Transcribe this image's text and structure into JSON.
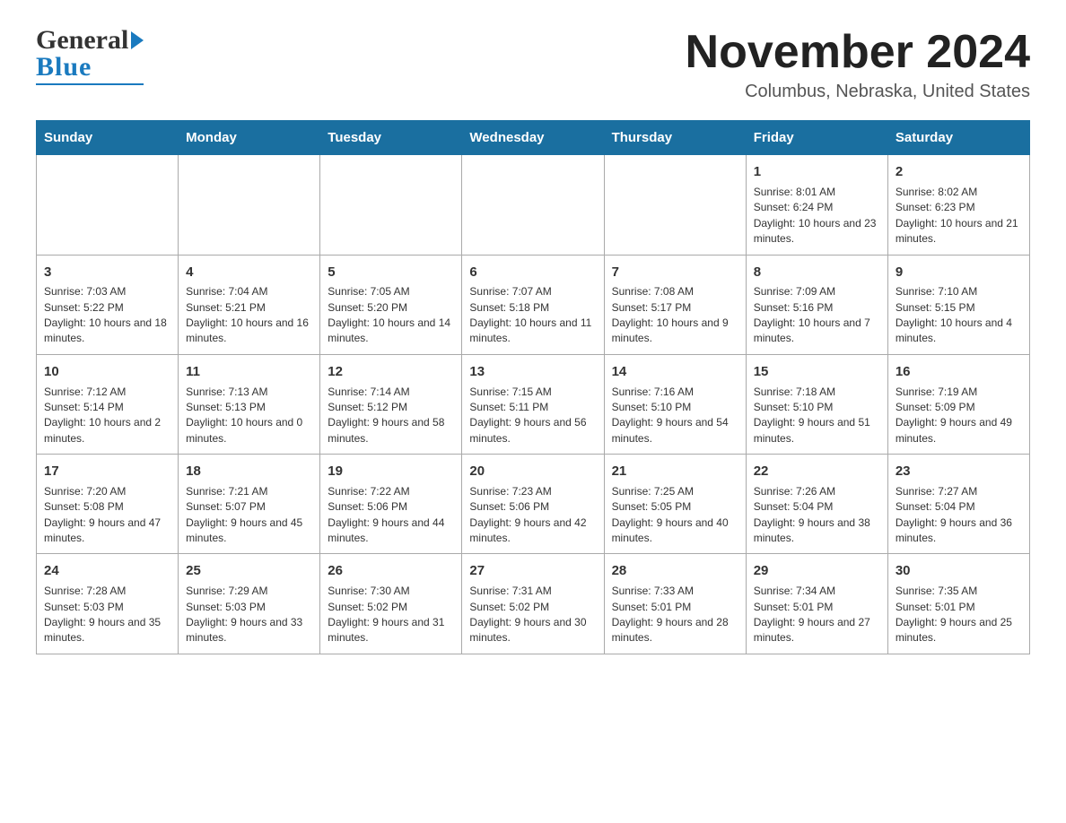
{
  "header": {
    "logo_general": "General",
    "logo_blue": "Blue",
    "month_title": "November 2024",
    "location": "Columbus, Nebraska, United States"
  },
  "weekdays": [
    "Sunday",
    "Monday",
    "Tuesday",
    "Wednesday",
    "Thursday",
    "Friday",
    "Saturday"
  ],
  "weeks": [
    [
      {
        "day": "",
        "info": ""
      },
      {
        "day": "",
        "info": ""
      },
      {
        "day": "",
        "info": ""
      },
      {
        "day": "",
        "info": ""
      },
      {
        "day": "",
        "info": ""
      },
      {
        "day": "1",
        "info": "Sunrise: 8:01 AM\nSunset: 6:24 PM\nDaylight: 10 hours and 23 minutes."
      },
      {
        "day": "2",
        "info": "Sunrise: 8:02 AM\nSunset: 6:23 PM\nDaylight: 10 hours and 21 minutes."
      }
    ],
    [
      {
        "day": "3",
        "info": "Sunrise: 7:03 AM\nSunset: 5:22 PM\nDaylight: 10 hours and 18 minutes."
      },
      {
        "day": "4",
        "info": "Sunrise: 7:04 AM\nSunset: 5:21 PM\nDaylight: 10 hours and 16 minutes."
      },
      {
        "day": "5",
        "info": "Sunrise: 7:05 AM\nSunset: 5:20 PM\nDaylight: 10 hours and 14 minutes."
      },
      {
        "day": "6",
        "info": "Sunrise: 7:07 AM\nSunset: 5:18 PM\nDaylight: 10 hours and 11 minutes."
      },
      {
        "day": "7",
        "info": "Sunrise: 7:08 AM\nSunset: 5:17 PM\nDaylight: 10 hours and 9 minutes."
      },
      {
        "day": "8",
        "info": "Sunrise: 7:09 AM\nSunset: 5:16 PM\nDaylight: 10 hours and 7 minutes."
      },
      {
        "day": "9",
        "info": "Sunrise: 7:10 AM\nSunset: 5:15 PM\nDaylight: 10 hours and 4 minutes."
      }
    ],
    [
      {
        "day": "10",
        "info": "Sunrise: 7:12 AM\nSunset: 5:14 PM\nDaylight: 10 hours and 2 minutes."
      },
      {
        "day": "11",
        "info": "Sunrise: 7:13 AM\nSunset: 5:13 PM\nDaylight: 10 hours and 0 minutes."
      },
      {
        "day": "12",
        "info": "Sunrise: 7:14 AM\nSunset: 5:12 PM\nDaylight: 9 hours and 58 minutes."
      },
      {
        "day": "13",
        "info": "Sunrise: 7:15 AM\nSunset: 5:11 PM\nDaylight: 9 hours and 56 minutes."
      },
      {
        "day": "14",
        "info": "Sunrise: 7:16 AM\nSunset: 5:10 PM\nDaylight: 9 hours and 54 minutes."
      },
      {
        "day": "15",
        "info": "Sunrise: 7:18 AM\nSunset: 5:10 PM\nDaylight: 9 hours and 51 minutes."
      },
      {
        "day": "16",
        "info": "Sunrise: 7:19 AM\nSunset: 5:09 PM\nDaylight: 9 hours and 49 minutes."
      }
    ],
    [
      {
        "day": "17",
        "info": "Sunrise: 7:20 AM\nSunset: 5:08 PM\nDaylight: 9 hours and 47 minutes."
      },
      {
        "day": "18",
        "info": "Sunrise: 7:21 AM\nSunset: 5:07 PM\nDaylight: 9 hours and 45 minutes."
      },
      {
        "day": "19",
        "info": "Sunrise: 7:22 AM\nSunset: 5:06 PM\nDaylight: 9 hours and 44 minutes."
      },
      {
        "day": "20",
        "info": "Sunrise: 7:23 AM\nSunset: 5:06 PM\nDaylight: 9 hours and 42 minutes."
      },
      {
        "day": "21",
        "info": "Sunrise: 7:25 AM\nSunset: 5:05 PM\nDaylight: 9 hours and 40 minutes."
      },
      {
        "day": "22",
        "info": "Sunrise: 7:26 AM\nSunset: 5:04 PM\nDaylight: 9 hours and 38 minutes."
      },
      {
        "day": "23",
        "info": "Sunrise: 7:27 AM\nSunset: 5:04 PM\nDaylight: 9 hours and 36 minutes."
      }
    ],
    [
      {
        "day": "24",
        "info": "Sunrise: 7:28 AM\nSunset: 5:03 PM\nDaylight: 9 hours and 35 minutes."
      },
      {
        "day": "25",
        "info": "Sunrise: 7:29 AM\nSunset: 5:03 PM\nDaylight: 9 hours and 33 minutes."
      },
      {
        "day": "26",
        "info": "Sunrise: 7:30 AM\nSunset: 5:02 PM\nDaylight: 9 hours and 31 minutes."
      },
      {
        "day": "27",
        "info": "Sunrise: 7:31 AM\nSunset: 5:02 PM\nDaylight: 9 hours and 30 minutes."
      },
      {
        "day": "28",
        "info": "Sunrise: 7:33 AM\nSunset: 5:01 PM\nDaylight: 9 hours and 28 minutes."
      },
      {
        "day": "29",
        "info": "Sunrise: 7:34 AM\nSunset: 5:01 PM\nDaylight: 9 hours and 27 minutes."
      },
      {
        "day": "30",
        "info": "Sunrise: 7:35 AM\nSunset: 5:01 PM\nDaylight: 9 hours and 25 minutes."
      }
    ]
  ]
}
